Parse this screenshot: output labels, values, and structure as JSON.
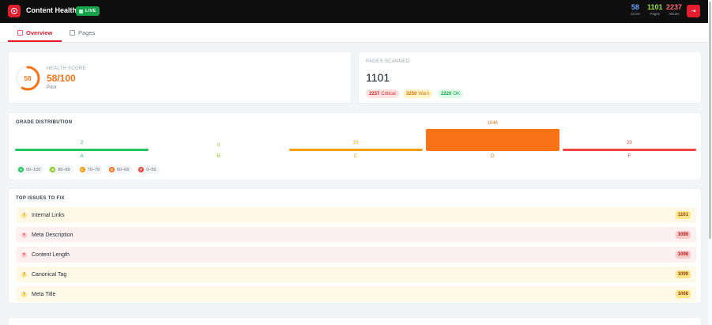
{
  "header": {
    "app_title": "Content Health",
    "live_badge": "LIVE",
    "logo_icon": "target-icon",
    "exit_icon": "exit-icon",
    "stats": [
      {
        "value": "58",
        "label": "Score",
        "color": "#60a5fa"
      },
      {
        "value": "1101",
        "label": "Pages",
        "color": "#a3e635"
      },
      {
        "value": "2237",
        "label": "Issues",
        "color": "#f87171"
      }
    ]
  },
  "tabs": [
    {
      "label": "Overview",
      "icon": "chart-icon",
      "active": true
    },
    {
      "label": "Pages",
      "icon": "document-icon",
      "active": false
    }
  ],
  "health": {
    "label": "HEALTH SCORE",
    "ring_value": "58",
    "value": "58/100",
    "status": "Poor",
    "score": 58,
    "accent": "#f97316"
  },
  "pages_scanned": {
    "label": "PAGES SCANNED",
    "value": "1101",
    "pills": [
      {
        "count": "2237",
        "label": "Critical"
      },
      {
        "count": "3250",
        "label": "Warn"
      },
      {
        "count": "2220",
        "label": "OK"
      }
    ]
  },
  "grades": {
    "title": "GRADE DISTRIBUTION",
    "items": [
      {
        "letter": "A",
        "count": "2",
        "value": 2,
        "color": "#22c55e"
      },
      {
        "letter": "B",
        "count": "0",
        "value": 0,
        "color": "#84cc16"
      },
      {
        "letter": "C",
        "count": "33",
        "value": 33,
        "color": "#f59e0b"
      },
      {
        "letter": "D",
        "count": "1046",
        "value": 1046,
        "color": "#f97316"
      },
      {
        "letter": "F",
        "count": "20",
        "value": 20,
        "color": "#ef4444"
      }
    ],
    "legend": [
      {
        "letter": "A",
        "range": "90–100",
        "color": "#22c55e"
      },
      {
        "letter": "B",
        "range": "80–89",
        "color": "#84cc16"
      },
      {
        "letter": "C",
        "range": "70–79",
        "color": "#f59e0b"
      },
      {
        "letter": "D",
        "range": "60–69",
        "color": "#f97316"
      },
      {
        "letter": "F",
        "range": "0–59",
        "color": "#ef4444"
      }
    ]
  },
  "issues": {
    "title": "TOP ISSUES TO FIX",
    "items": [
      {
        "name": "Internal Links",
        "count": "1101",
        "severity": "warn",
        "icon": "!"
      },
      {
        "name": "Meta Description",
        "count": "1099",
        "severity": "error",
        "icon": "×"
      },
      {
        "name": "Content Length",
        "count": "1098",
        "severity": "error",
        "icon": "×"
      },
      {
        "name": "Canonical Tag",
        "count": "1099",
        "severity": "warn",
        "icon": "!"
      },
      {
        "name": "Meta Title",
        "count": "1068",
        "severity": "warn",
        "icon": "!"
      }
    ]
  }
}
